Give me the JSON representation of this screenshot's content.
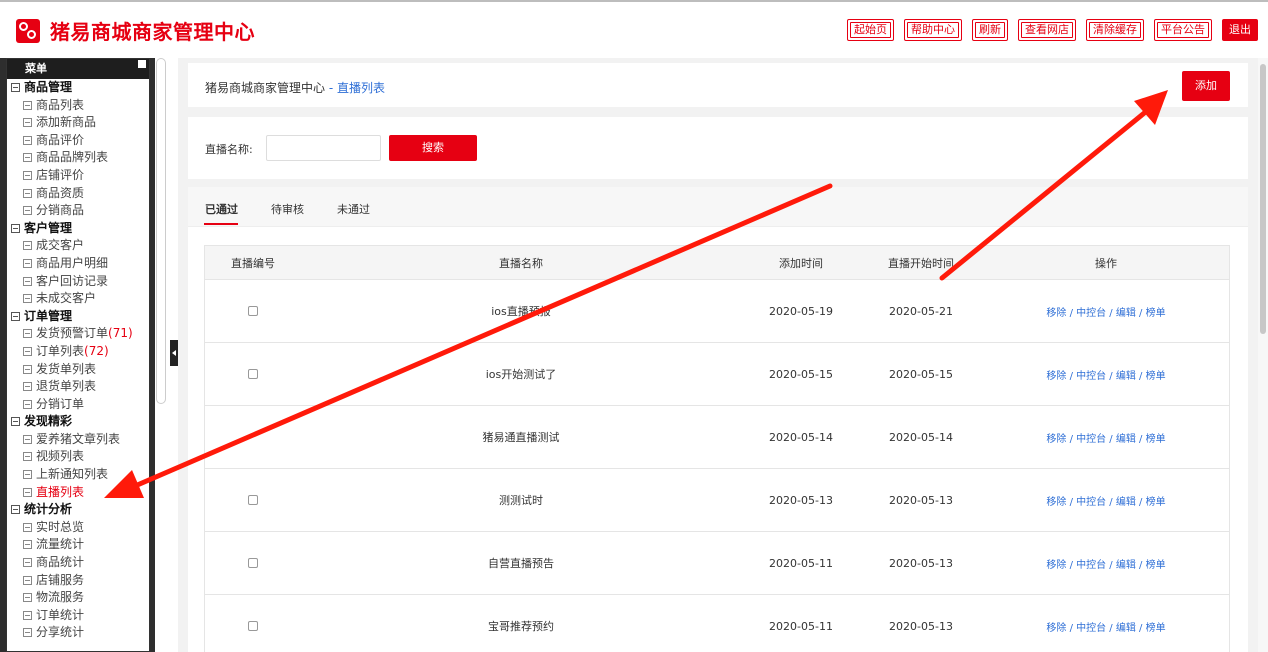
{
  "header": {
    "brand": "猪易商城商家管理中心",
    "buttons": [
      "起始页",
      "帮助中心",
      "刷新",
      "查看网店",
      "清除缓存",
      "平台公告"
    ],
    "logout": "退出"
  },
  "sidebar": {
    "title": "菜单",
    "groups": [
      {
        "label": "商品管理",
        "items": [
          "商品列表",
          "添加新商品",
          "商品评价",
          "商品品牌列表",
          "店铺评价",
          "商品资质",
          "分销商品"
        ]
      },
      {
        "label": "客户管理",
        "items": [
          "成交客户",
          "商品用户明细",
          "客户回访记录",
          "未成交客户"
        ]
      },
      {
        "label": "订单管理",
        "items": [
          "发货预警订单",
          "订单列表",
          "发货单列表",
          "退货单列表",
          "分销订单"
        ]
      },
      {
        "label": "发现精彩",
        "items": [
          "爱养猪文章列表",
          "视频列表",
          "上新通知列表",
          "直播列表"
        ]
      },
      {
        "label": "统计分析",
        "items": [
          "实时总览",
          "流量统计",
          "商品统计",
          "店铺服务",
          "物流服务",
          "订单统计",
          "分享统计"
        ]
      }
    ],
    "counts": {
      "warning_orders": "(71)",
      "order_list": "(72)"
    }
  },
  "breadcrumb": {
    "root": "猪易商城商家管理中心",
    "sep": " - ",
    "current": "直播列表"
  },
  "add_button": "添加",
  "search": {
    "label": "直播名称:",
    "placeholder": "",
    "button": "搜索"
  },
  "tabs": [
    "已通过",
    "待审核",
    "未通过"
  ],
  "table": {
    "headers": [
      "直播编号",
      "直播名称",
      "添加时间",
      "直播开始时间",
      "操作"
    ],
    "ops_text": "移除 / 中控台 / 编辑 / 榜单",
    "rows": [
      {
        "name": "ios直播预报",
        "added": "2020-05-19",
        "start": "2020-05-21"
      },
      {
        "name": "ios开始测试了",
        "added": "2020-05-15",
        "start": "2020-05-15"
      },
      {
        "name": "猪易通直播测试",
        "added": "2020-05-14",
        "start": "2020-05-14"
      },
      {
        "name": "测测试时",
        "added": "2020-05-13",
        "start": "2020-05-13"
      },
      {
        "name": "自营直播预告",
        "added": "2020-05-11",
        "start": "2020-05-13"
      },
      {
        "name": "宝哥推荐预约",
        "added": "2020-05-11",
        "start": "2020-05-13"
      }
    ]
  },
  "colors": {
    "accent": "#e60012",
    "link": "#2f6fd6",
    "sidebar_bg": "#2e2e2e"
  }
}
